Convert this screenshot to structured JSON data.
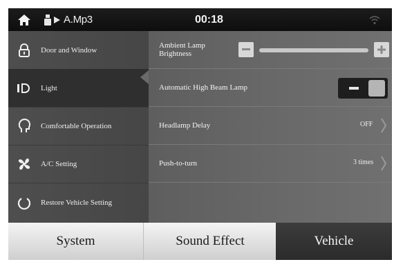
{
  "status_bar": {
    "media_label": "A.Mp3",
    "time": "00:18"
  },
  "sidebar": {
    "items": [
      {
        "label": "Door and Window",
        "icon": "lock-icon"
      },
      {
        "label": "Light",
        "icon": "light-icon",
        "active": true
      },
      {
        "label": "Comfortable Operation",
        "icon": "head-icon"
      },
      {
        "label": "A/C Setting",
        "icon": "fan-icon"
      },
      {
        "label": "Restore Vehicle Setting",
        "icon": "restore-icon"
      }
    ]
  },
  "settings": {
    "ambient": {
      "label_line1": "Ambient Lamp",
      "label_line2": "Brightness"
    },
    "high_beam": {
      "label": "Automatic High Beam Lamp",
      "state": "on"
    },
    "headlamp_delay": {
      "label": "Headlamp Delay",
      "value": "OFF"
    },
    "push_to_turn": {
      "label": "Push-to-turn",
      "value": "3 times"
    }
  },
  "tabs": [
    {
      "label": "System"
    },
    {
      "label": "Sound Effect"
    },
    {
      "label": "Vehicle",
      "active": true
    }
  ],
  "colors": {
    "sidebar_bg": "#4e4e4e",
    "active_item_bg": "#2f2f2f",
    "content_bg": "#6a6a6a",
    "active_tab_bg": "#333333"
  }
}
